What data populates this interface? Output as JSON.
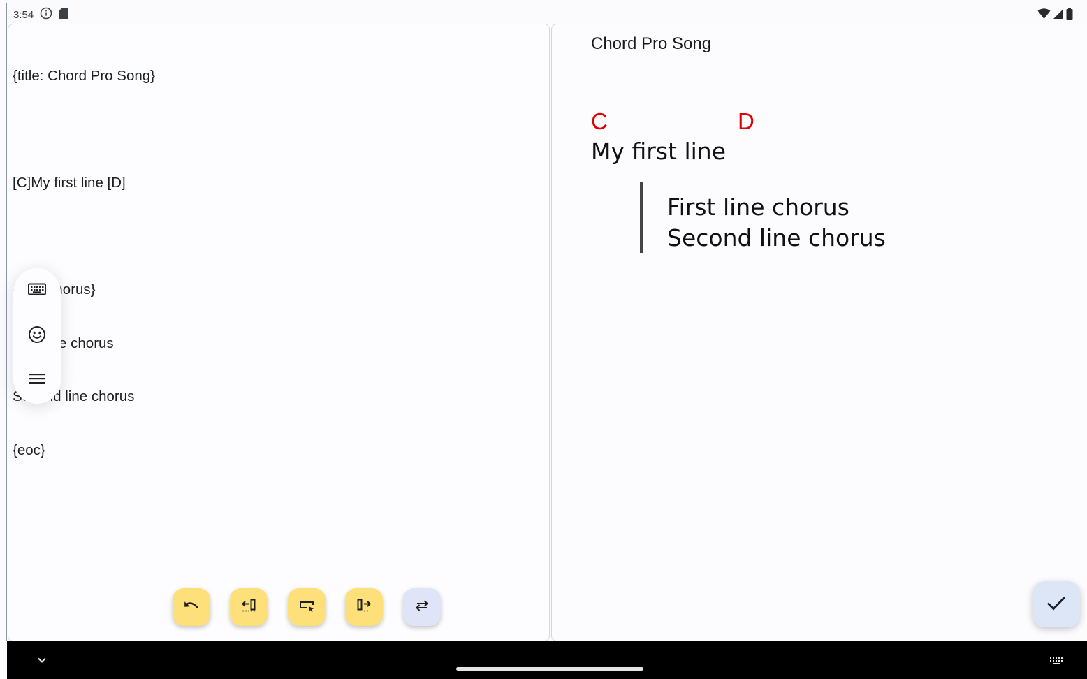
{
  "status_bar": {
    "time": "3:54",
    "icons": [
      "info-icon",
      "sd-card-icon",
      "wifi-icon",
      "signal-icon",
      "battery-icon"
    ]
  },
  "editor": {
    "lines": [
      "{title: Chord Pro Song}",
      "",
      "[C]My first line [D]",
      "",
      "{soc: chorus}",
      "First line chorus",
      "Second line chorus",
      "{eoc}"
    ]
  },
  "preview": {
    "title": "Chord Pro Song",
    "chords": [
      "C",
      "D"
    ],
    "lyric_line": "My first line",
    "chorus_lines": [
      "First line chorus",
      "Second line chorus"
    ],
    "chord_color": "#e00000"
  },
  "side_toolbar": {
    "icons": [
      "keyboard-icon",
      "emoji-icon",
      "menu-icon"
    ]
  },
  "edit_toolbar": {
    "buttons": [
      "undo-icon",
      "indent-left-icon",
      "select-icon",
      "indent-right-icon",
      "repeat-icon"
    ],
    "accent": "#fde07a"
  },
  "save_fab": {
    "icon": "check-icon"
  },
  "nav_bar": {
    "icons": [
      "chevron-down-icon",
      "keyboard-icon"
    ]
  }
}
